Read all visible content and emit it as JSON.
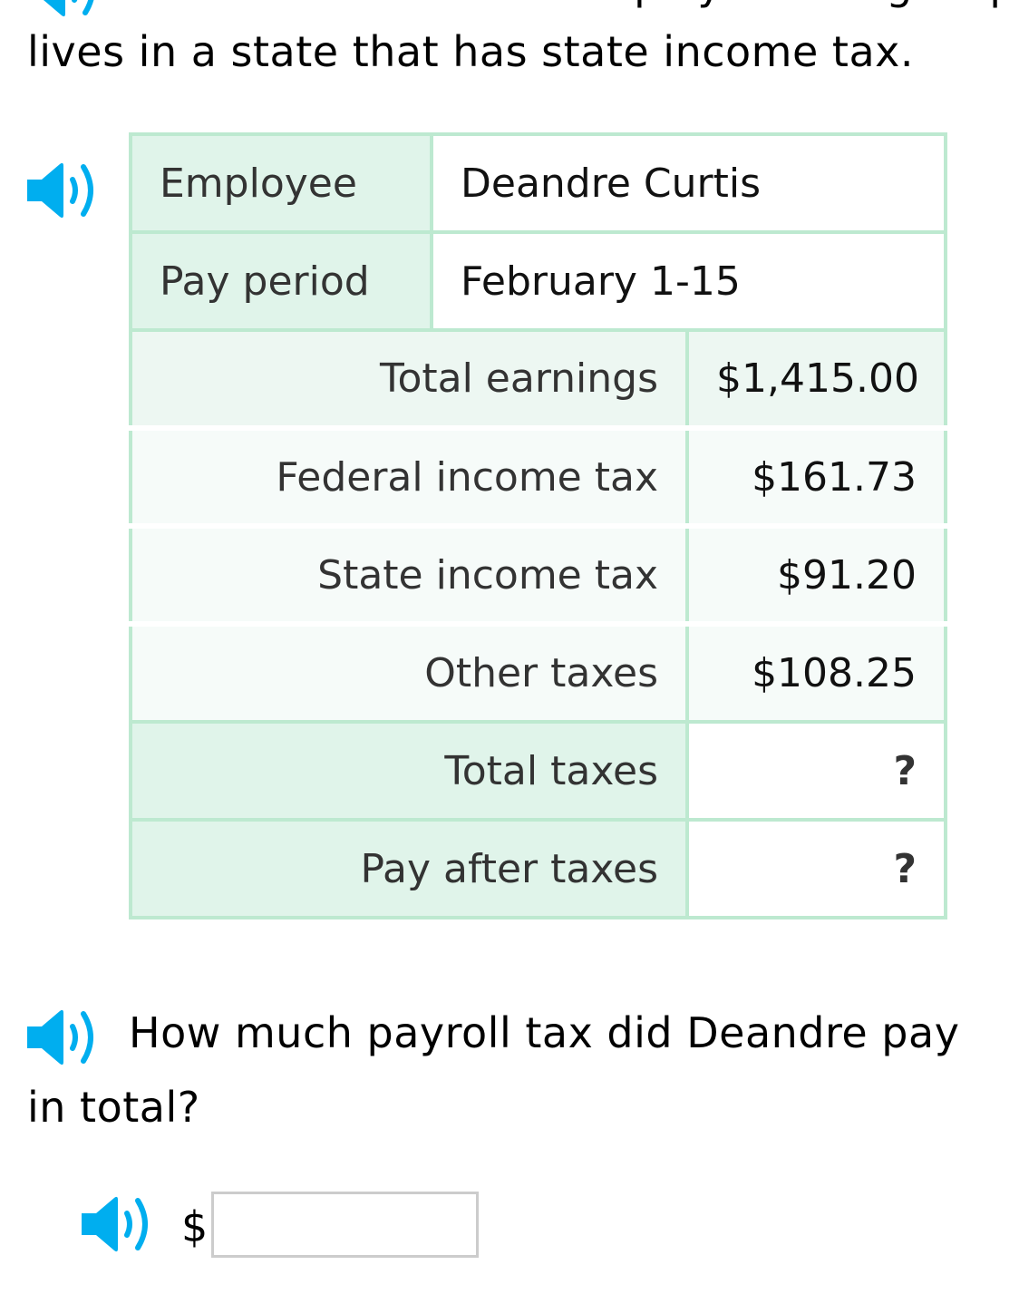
{
  "prompt": {
    "clipped_line": "Deandre Curtis is an employee who gets paid by pay",
    "intro_text": "lives in a state that has state income tax."
  },
  "icons": {
    "speaker": "speaker-icon",
    "accent_color": "#00aeef"
  },
  "pay_stub": {
    "employee_label": "Employee",
    "employee_value": "Deandre Curtis",
    "period_label": "Pay period",
    "period_value": "February 1-15",
    "rows": [
      {
        "label": "Total earnings",
        "value": "$1,415.00"
      },
      {
        "label": "Federal income tax",
        "value": "$161.73"
      },
      {
        "label": "State income tax",
        "value": "$91.20"
      },
      {
        "label": "Other taxes",
        "value": "$108.25"
      }
    ],
    "results": [
      {
        "label": "Total taxes",
        "value": "?"
      },
      {
        "label": "Pay after taxes",
        "value": "?"
      }
    ]
  },
  "question": {
    "line1": "How much payroll tax did Deandre pay",
    "line2": "in total?"
  },
  "answer": {
    "currency": "$",
    "value": ""
  }
}
